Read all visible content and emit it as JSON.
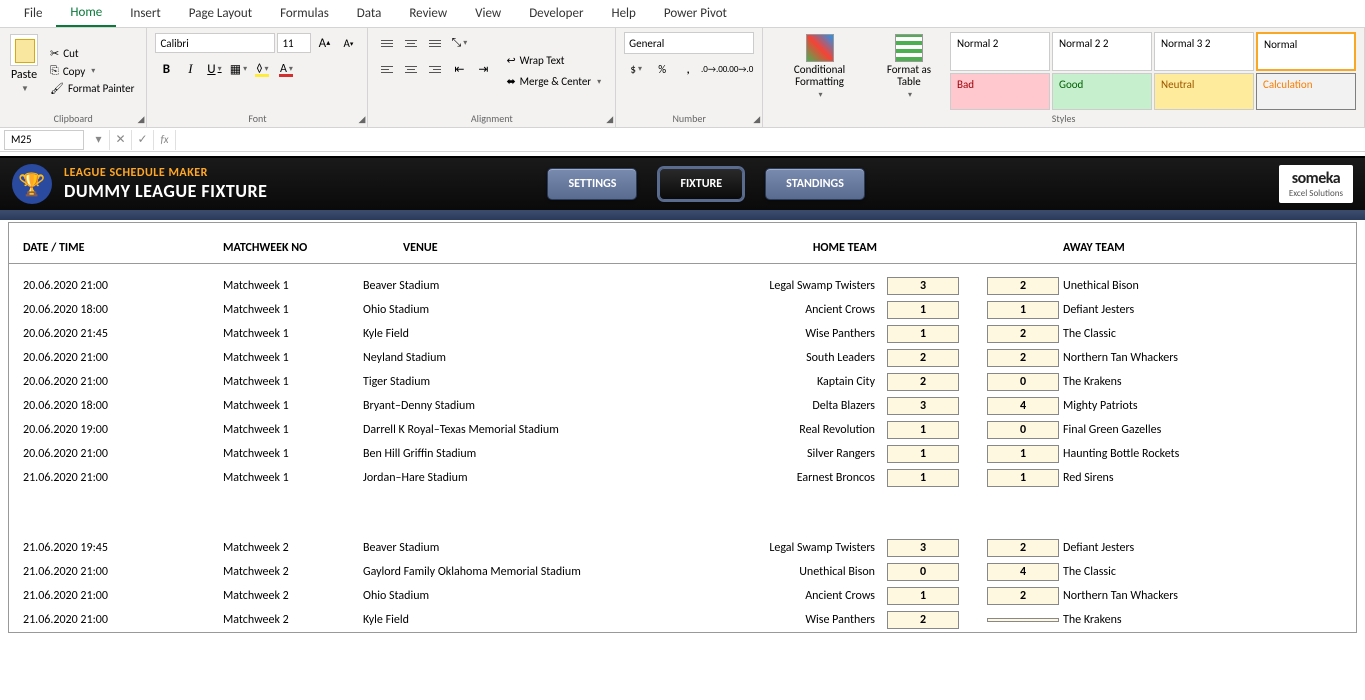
{
  "tabs": {
    "file": "File",
    "home": "Home",
    "insert": "Insert",
    "page_layout": "Page Layout",
    "formulas": "Formulas",
    "data": "Data",
    "review": "Review",
    "view": "View",
    "developer": "Developer",
    "help": "Help",
    "power_pivot": "Power Pivot"
  },
  "clipboard": {
    "label": "Clipboard",
    "paste": "Paste",
    "cut": "Cut",
    "copy": "Copy",
    "format_painter": "Format Painter"
  },
  "font": {
    "label": "Font",
    "name": "Calibri",
    "size": "11",
    "inc": "A",
    "dec": "A"
  },
  "alignment": {
    "label": "Alignment",
    "wrap": "Wrap Text",
    "merge": "Merge & Center"
  },
  "number": {
    "label": "Number",
    "format": "General"
  },
  "conditional": {
    "label": "Conditional Formatting"
  },
  "format_table": {
    "label": "Format as Table"
  },
  "styles": {
    "label": "Styles",
    "n2": "Normal 2",
    "n22": "Normal 2 2",
    "n32": "Normal 3 2",
    "normal": "Normal",
    "bad": "Bad",
    "good": "Good",
    "neutral": "Neutral",
    "calc": "Calculation"
  },
  "name_box": "M25",
  "header": {
    "t1": "LEAGUE SCHEDULE MAKER",
    "t2": "DUMMY LEAGUE FIXTURE",
    "settings": "SETTINGS",
    "fixture": "FIXTURE",
    "standings": "STANDINGS",
    "logo1": "someka",
    "logo2": "Excel Solutions"
  },
  "cols": {
    "date": "DATE / TIME",
    "mw": "MATCHWEEK NO",
    "venue": "VENUE",
    "home": "HOME TEAM",
    "away": "AWAY TEAM"
  },
  "rows": [
    {
      "dt": "20.06.2020 21:00",
      "mw": "Matchweek 1",
      "venue": "Beaver Stadium",
      "home": "Legal Swamp Twisters",
      "hs": "3",
      "as": "2",
      "away": "Unethical Bison"
    },
    {
      "dt": "20.06.2020 18:00",
      "mw": "Matchweek 1",
      "venue": "Ohio Stadium",
      "home": "Ancient Crows",
      "hs": "1",
      "as": "1",
      "away": "Defiant Jesters"
    },
    {
      "dt": "20.06.2020 21:45",
      "mw": "Matchweek 1",
      "venue": "Kyle Field",
      "home": "Wise Panthers",
      "hs": "1",
      "as": "2",
      "away": "The Classic"
    },
    {
      "dt": "20.06.2020 21:00",
      "mw": "Matchweek 1",
      "venue": "Neyland Stadium",
      "home": "South Leaders",
      "hs": "2",
      "as": "2",
      "away": "Northern Tan Whackers"
    },
    {
      "dt": "20.06.2020 21:00",
      "mw": "Matchweek 1",
      "venue": "Tiger Stadium",
      "home": "Kaptain City",
      "hs": "2",
      "as": "0",
      "away": "The Krakens"
    },
    {
      "dt": "20.06.2020 18:00",
      "mw": "Matchweek 1",
      "venue": "Bryant–Denny Stadium",
      "home": "Delta Blazers",
      "hs": "3",
      "as": "4",
      "away": "Mighty Patriots"
    },
    {
      "dt": "20.06.2020 19:00",
      "mw": "Matchweek 1",
      "venue": "Darrell K Royal–Texas Memorial Stadium",
      "home": "Real Revolution",
      "hs": "1",
      "as": "0",
      "away": "Final Green Gazelles"
    },
    {
      "dt": "20.06.2020 21:00",
      "mw": "Matchweek 1",
      "venue": "Ben Hill Griffin Stadium",
      "home": "Silver Rangers",
      "hs": "1",
      "as": "1",
      "away": "Haunting Bottle Rockets"
    },
    {
      "dt": "21.06.2020 21:00",
      "mw": "Matchweek 1",
      "venue": "Jordan–Hare Stadium",
      "home": "Earnest Broncos",
      "hs": "1",
      "as": "1",
      "away": "Red Sirens"
    }
  ],
  "rows2": [
    {
      "dt": "21.06.2020 19:45",
      "mw": "Matchweek 2",
      "venue": "Beaver Stadium",
      "home": "Legal Swamp Twisters",
      "hs": "3",
      "as": "2",
      "away": "Defiant Jesters"
    },
    {
      "dt": "21.06.2020 21:00",
      "mw": "Matchweek 2",
      "venue": "Gaylord Family Oklahoma Memorial Stadium",
      "home": "Unethical Bison",
      "hs": "0",
      "as": "4",
      "away": "The Classic"
    },
    {
      "dt": "21.06.2020 21:00",
      "mw": "Matchweek 2",
      "venue": "Ohio Stadium",
      "home": "Ancient Crows",
      "hs": "1",
      "as": "2",
      "away": "Northern Tan Whackers"
    },
    {
      "dt": "21.06.2020 21:00",
      "mw": "Matchweek 2",
      "venue": "Kyle Field",
      "home": "Wise Panthers",
      "hs": "2",
      "as": "",
      "away": "The Krakens"
    }
  ]
}
